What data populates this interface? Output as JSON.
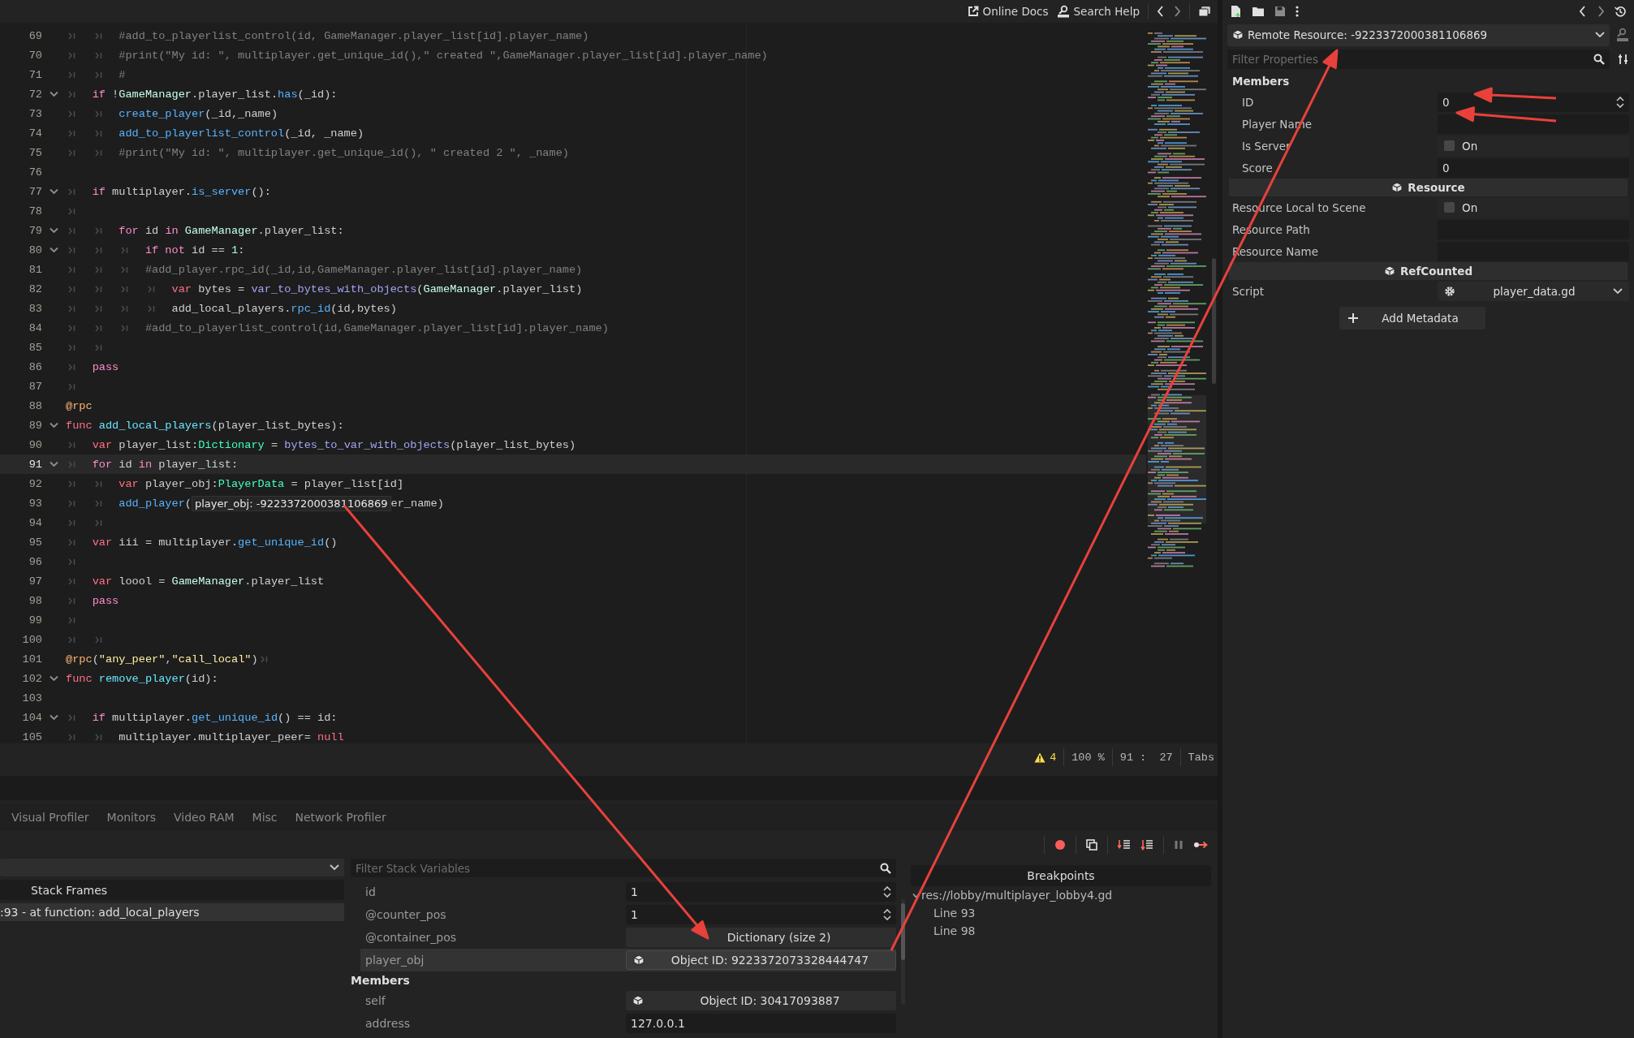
{
  "toolbar": {
    "links": [
      {
        "label": "Online Docs",
        "kind": "external"
      },
      {
        "label": "Search Help",
        "kind": "doc"
      }
    ]
  },
  "editor": {
    "lines": [
      {
        "number": "69",
        "fold": false,
        "current": false,
        "tokens": [
          {
            "kind": "tab"
          },
          {
            "kind": "tab"
          },
          {
            "kind": "comment",
            "text": "#add_to_playerlist_control(id, GameManager.player_list[id].player_name)"
          }
        ]
      },
      {
        "number": "70",
        "fold": false,
        "current": false,
        "tokens": [
          {
            "kind": "tab"
          },
          {
            "kind": "tab"
          },
          {
            "kind": "comment",
            "text": "#print(\"My id: \", multiplayer.get_unique_id(),\" created \",GameManager.player_list[id].player_name)"
          }
        ]
      },
      {
        "number": "71",
        "fold": false,
        "current": false,
        "tokens": [
          {
            "kind": "tab"
          },
          {
            "kind": "tab"
          },
          {
            "kind": "comment",
            "text": "#"
          }
        ]
      },
      {
        "number": "72",
        "fold": true,
        "current": false,
        "tokens": [
          {
            "kind": "tab"
          },
          {
            "kind": "keyword",
            "text": "if"
          },
          {
            "kind": "plain",
            "text": " !"
          },
          {
            "kind": "class",
            "text": "GameManager"
          },
          {
            "kind": "plain",
            "text": ".player_list."
          },
          {
            "kind": "call",
            "text": "has"
          },
          {
            "kind": "plain",
            "text": "(_id):"
          }
        ]
      },
      {
        "number": "73",
        "fold": false,
        "current": false,
        "tokens": [
          {
            "kind": "tab"
          },
          {
            "kind": "tab"
          },
          {
            "kind": "call",
            "text": "create_player"
          },
          {
            "kind": "plain",
            "text": "(_id,_name)"
          }
        ]
      },
      {
        "number": "74",
        "fold": false,
        "current": false,
        "tokens": [
          {
            "kind": "tab"
          },
          {
            "kind": "tab"
          },
          {
            "kind": "call",
            "text": "add_to_playerlist_control"
          },
          {
            "kind": "plain",
            "text": "(_id, _name)"
          }
        ]
      },
      {
        "number": "75",
        "fold": false,
        "current": false,
        "tokens": [
          {
            "kind": "tab"
          },
          {
            "kind": "tab"
          },
          {
            "kind": "comment",
            "text": "#print(\"My id: \", multiplayer.get_unique_id(), \" created 2 \", _name)"
          }
        ]
      },
      {
        "number": "76",
        "fold": false,
        "current": false
      },
      {
        "number": "77",
        "fold": true,
        "current": false,
        "tokens": [
          {
            "kind": "tab"
          },
          {
            "kind": "keyword",
            "text": "if"
          },
          {
            "kind": "plain",
            "text": " multiplayer."
          },
          {
            "kind": "call",
            "text": "is_server"
          },
          {
            "kind": "plain",
            "text": "():"
          }
        ]
      },
      {
        "number": "78",
        "fold": false,
        "current": false,
        "tokens": [
          {
            "kind": "tab"
          }
        ]
      },
      {
        "number": "79",
        "fold": true,
        "current": false,
        "tokens": [
          {
            "kind": "tab"
          },
          {
            "kind": "tab"
          },
          {
            "kind": "keyword",
            "text": "for"
          },
          {
            "kind": "plain",
            "text": " id "
          },
          {
            "kind": "keyword",
            "text": "in"
          },
          {
            "kind": "class",
            "text": " GameManager"
          },
          {
            "kind": "plain",
            "text": ".player_list:"
          }
        ]
      },
      {
        "number": "80",
        "fold": true,
        "current": false,
        "tokens": [
          {
            "kind": "tab"
          },
          {
            "kind": "tab"
          },
          {
            "kind": "tab"
          },
          {
            "kind": "keyword",
            "text": "if"
          },
          {
            "kind": "keyword",
            "text": " not"
          },
          {
            "kind": "plain",
            "text": " id == "
          },
          {
            "kind": "number",
            "text": "1"
          },
          {
            "kind": "plain",
            "text": ":"
          }
        ]
      },
      {
        "number": "81",
        "fold": false,
        "current": false,
        "tokens": [
          {
            "kind": "tab"
          },
          {
            "kind": "tab"
          },
          {
            "kind": "tab"
          },
          {
            "kind": "comment",
            "text": "#add_player.rpc_id(_id,id,GameManager.player_list[id].player_name)"
          }
        ]
      },
      {
        "number": "82",
        "fold": false,
        "current": false,
        "tokens": [
          {
            "kind": "tab"
          },
          {
            "kind": "tab"
          },
          {
            "kind": "tab"
          },
          {
            "kind": "tab"
          },
          {
            "kind": "declaration",
            "text": "var"
          },
          {
            "kind": "plain",
            "text": " bytes = "
          },
          {
            "kind": "builtin",
            "text": "var_to_bytes_with_objects"
          },
          {
            "kind": "plain",
            "text": "("
          },
          {
            "kind": "class",
            "text": "GameManager"
          },
          {
            "kind": "plain",
            "text": ".player_list)"
          }
        ]
      },
      {
        "number": "83",
        "fold": false,
        "current": false,
        "tokens": [
          {
            "kind": "tab"
          },
          {
            "kind": "tab"
          },
          {
            "kind": "tab"
          },
          {
            "kind": "tab"
          },
          {
            "kind": "plain",
            "text": "add_local_players."
          },
          {
            "kind": "call",
            "text": "rpc_id"
          },
          {
            "kind": "plain",
            "text": "(id,bytes)"
          }
        ]
      },
      {
        "number": "84",
        "fold": false,
        "current": false,
        "tokens": [
          {
            "kind": "tab"
          },
          {
            "kind": "tab"
          },
          {
            "kind": "tab"
          },
          {
            "kind": "comment",
            "text": "#add_to_playerlist_control(id,GameManager.player_list[id].player_name)"
          }
        ]
      },
      {
        "number": "85",
        "fold": false,
        "current": false,
        "tokens": [
          {
            "kind": "tab"
          },
          {
            "kind": "tab"
          }
        ]
      },
      {
        "number": "86",
        "fold": false,
        "current": false,
        "tokens": [
          {
            "kind": "tab"
          },
          {
            "kind": "keyword",
            "text": "pass"
          }
        ]
      },
      {
        "number": "87",
        "fold": false,
        "current": false,
        "tokens": [
          {
            "kind": "tab"
          }
        ]
      },
      {
        "number": "88",
        "fold": false,
        "current": false,
        "tokens": [
          {
            "kind": "annotation",
            "text": "@rpc"
          }
        ]
      },
      {
        "number": "89",
        "fold": true,
        "current": false,
        "tokens": [
          {
            "kind": "declaration",
            "text": "func"
          },
          {
            "kind": "definition",
            "text": " add_local_players"
          },
          {
            "kind": "plain",
            "text": "(player_list_bytes):"
          }
        ]
      },
      {
        "number": "90",
        "fold": false,
        "current": false,
        "tokens": [
          {
            "kind": "tab"
          },
          {
            "kind": "declaration",
            "text": "var"
          },
          {
            "kind": "plain",
            "text": " player_list:"
          },
          {
            "kind": "type",
            "text": "Dictionary"
          },
          {
            "kind": "plain",
            "text": " = "
          },
          {
            "kind": "builtin",
            "text": "bytes_to_var_with_objects"
          },
          {
            "kind": "plain",
            "text": "(player_list_bytes)"
          }
        ]
      },
      {
        "number": "91",
        "fold": true,
        "current": true,
        "tokens": [
          {
            "kind": "tab"
          },
          {
            "kind": "keyword",
            "text": "for"
          },
          {
            "kind": "plain",
            "text": " id "
          },
          {
            "kind": "keyword",
            "text": "in"
          },
          {
            "kind": "plain",
            "text": " player_list:"
          }
        ]
      },
      {
        "number": "92",
        "fold": false,
        "current": false,
        "tokens": [
          {
            "kind": "tab"
          },
          {
            "kind": "tab"
          },
          {
            "kind": "declaration",
            "text": "var"
          },
          {
            "kind": "plain",
            "text": " player_obj:"
          },
          {
            "kind": "type",
            "text": "PlayerData"
          },
          {
            "kind": "plain",
            "text": " = player_list[id]"
          }
        ]
      },
      {
        "number": "93",
        "fold": false,
        "current": false,
        "tokens": [
          {
            "kind": "tab"
          },
          {
            "kind": "tab"
          },
          {
            "kind": "call",
            "text": "add_player"
          },
          {
            "kind": "plain",
            "text": "("
          },
          {
            "kind": "tooltip",
            "text": "player_obj: -9223372000381106869"
          },
          {
            "kind": "plain",
            "text": "er_name)"
          }
        ]
      },
      {
        "number": "94",
        "fold": false,
        "current": false,
        "tokens": [
          {
            "kind": "tab"
          },
          {
            "kind": "tab"
          }
        ]
      },
      {
        "number": "95",
        "fold": false,
        "current": false,
        "tokens": [
          {
            "kind": "tab"
          },
          {
            "kind": "declaration",
            "text": "var"
          },
          {
            "kind": "plain",
            "text": " iii = multiplayer."
          },
          {
            "kind": "call",
            "text": "get_unique_id"
          },
          {
            "kind": "plain",
            "text": "()"
          }
        ]
      },
      {
        "number": "96",
        "fold": false,
        "current": false,
        "tokens": [
          {
            "kind": "tab"
          }
        ]
      },
      {
        "number": "97",
        "fold": false,
        "current": false,
        "tokens": [
          {
            "kind": "tab"
          },
          {
            "kind": "declaration",
            "text": "var"
          },
          {
            "kind": "plain",
            "text": " loool = "
          },
          {
            "kind": "class",
            "text": "GameManager"
          },
          {
            "kind": "plain",
            "text": ".player_list"
          }
        ]
      },
      {
        "number": "98",
        "fold": false,
        "current": false,
        "tokens": [
          {
            "kind": "tab"
          },
          {
            "kind": "keyword",
            "text": "pass"
          }
        ]
      },
      {
        "number": "99",
        "fold": false,
        "current": false,
        "tokens": [
          {
            "kind": "tab"
          }
        ]
      },
      {
        "number": "100",
        "fold": false,
        "current": false,
        "tokens": [
          {
            "kind": "tab"
          },
          {
            "kind": "tab"
          }
        ]
      },
      {
        "number": "101",
        "fold": false,
        "current": false,
        "tokens": [
          {
            "kind": "annotation",
            "text": "@rpc"
          },
          {
            "kind": "plain",
            "text": "("
          },
          {
            "kind": "string",
            "text": "\"any_peer\""
          },
          {
            "kind": "plain",
            "text": ","
          },
          {
            "kind": "string",
            "text": "\"call_local\""
          },
          {
            "kind": "plain",
            "text": ")"
          },
          {
            "kind": "tab"
          }
        ]
      },
      {
        "number": "102",
        "fold": true,
        "current": false,
        "tokens": [
          {
            "kind": "declaration",
            "text": "func"
          },
          {
            "kind": "definition",
            "text": " remove_player"
          },
          {
            "kind": "plain",
            "text": "(id):"
          }
        ]
      },
      {
        "number": "103",
        "fold": false,
        "current": false
      },
      {
        "number": "104",
        "fold": true,
        "current": false,
        "tokens": [
          {
            "kind": "tab"
          },
          {
            "kind": "keyword",
            "text": "if"
          },
          {
            "kind": "plain",
            "text": " multiplayer."
          },
          {
            "kind": "call",
            "text": "get_unique_id"
          },
          {
            "kind": "plain",
            "text": "() == id:"
          }
        ]
      },
      {
        "number": "105",
        "fold": false,
        "current": false,
        "tokens": [
          {
            "kind": "tab"
          },
          {
            "kind": "tab"
          },
          {
            "kind": "plain",
            "text": "multiplayer.multiplayer_peer= "
          },
          {
            "kind": "declaration",
            "text": "null"
          }
        ]
      }
    ],
    "status_bar": {
      "warnings": "4",
      "zoom": "100 %",
      "position": "91 :  27",
      "indent": "Tabs"
    }
  },
  "bottom_panel": {
    "tabs": [
      {
        "label": "Visual Profiler",
        "selected": false
      },
      {
        "label": "Monitors",
        "selected": false
      },
      {
        "label": "Video RAM",
        "selected": false
      },
      {
        "label": "Misc",
        "selected": false
      },
      {
        "label": "Network Profiler",
        "selected": false
      }
    ],
    "stack_frames": {
      "title": "Stack Frames",
      "frames": [
        {
          "label": ":93 - at function: add_local_players",
          "selected": true
        }
      ]
    },
    "variables": {
      "placeholder": "Filter Stack Variables",
      "locals": [
        {
          "name": "id",
          "kind": "spin",
          "value": "1",
          "selected": false
        },
        {
          "name": "@counter_pos",
          "kind": "spin",
          "value": "1",
          "selected": false
        },
        {
          "name": "@container_pos",
          "kind": "button",
          "value": "Dictionary (size 2)",
          "selected": false
        },
        {
          "name": "player_obj",
          "kind": "object",
          "value": "Object ID: 9223372073328444747",
          "selected": true
        }
      ],
      "members": {
        "title": "Members",
        "rows": [
          {
            "name": "self",
            "kind": "object",
            "value": "Object ID: 30417093887",
            "selected": false
          },
          {
            "name": "address",
            "kind": "text",
            "value": "127.0.0.1",
            "selected": false
          }
        ]
      }
    },
    "breakpoints": {
      "title": "Breakpoints",
      "tree": [
        {
          "label": "res://lobby/multiplayer_lobby4.gd",
          "expanded": true,
          "children": [
            {
              "label": "Line 93"
            },
            {
              "label": "Line 98"
            }
          ]
        }
      ]
    }
  },
  "inspector": {
    "resource": "Remote Resource: -9223372000381106869",
    "placeholder": "Filter Properties",
    "sections": [
      {
        "title": "Members",
        "kind": "category",
        "rows": [
          {
            "label": "ID",
            "kind": "spin",
            "value": "0"
          },
          {
            "label": "Player Name",
            "kind": "text"
          },
          {
            "label": "Is Server",
            "kind": "check",
            "checked": false,
            "text": "On"
          },
          {
            "label": "Score",
            "kind": "number",
            "value": "0"
          }
        ]
      },
      {
        "title": "Resource",
        "kind": "class",
        "rows": [
          {
            "label": "Resource Local to Scene",
            "kind": "check",
            "checked": false,
            "text": "On"
          },
          {
            "label": "Resource Path",
            "kind": "text"
          },
          {
            "label": "Resource Name",
            "kind": "text"
          }
        ]
      },
      {
        "title": "RefCounted",
        "kind": "class",
        "rows": [
          {
            "label": "Script",
            "kind": "script",
            "value": "player_data.gd"
          }
        ]
      }
    ],
    "add_button": "Add Metadata"
  }
}
